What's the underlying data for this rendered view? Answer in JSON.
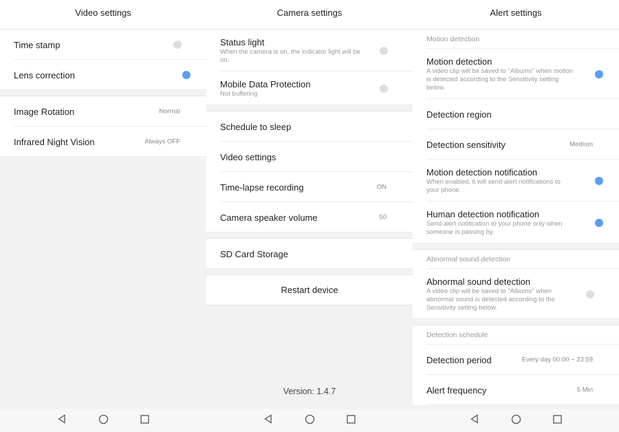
{
  "colors": {
    "toggle_on": "#5b9ef0",
    "toggle_off": "#dedede"
  },
  "panels": [
    {
      "title": "Video settings",
      "items": [
        {
          "type": "row",
          "title": "Time stamp",
          "toggle": false
        },
        {
          "type": "row",
          "title": "Lens correction",
          "toggle": true,
          "last": true
        },
        {
          "type": "gap"
        },
        {
          "type": "row",
          "title": "Image Rotation",
          "value": "Normal"
        },
        {
          "type": "row",
          "title": "Infrared Night Vision",
          "value": "Always OFF",
          "last": true
        }
      ]
    },
    {
      "title": "Camera settings",
      "version": "Version: 1.4.7",
      "items": [
        {
          "type": "row",
          "title": "Status light",
          "desc": "When the camera is on, the indicator light will be on.",
          "toggle": false
        },
        {
          "type": "row",
          "title": "Mobile Data Protection",
          "desc": "Not buffering",
          "toggle": false,
          "last": true
        },
        {
          "type": "gap"
        },
        {
          "type": "row",
          "title": "Schedule to sleep"
        },
        {
          "type": "row",
          "title": "Video settings"
        },
        {
          "type": "row",
          "title": "Time-lapse recording",
          "value": "ON"
        },
        {
          "type": "row",
          "title": "Camera speaker volume",
          "value": "50",
          "last": true
        },
        {
          "type": "gap"
        },
        {
          "type": "row",
          "title": "SD Card Storage",
          "last": true
        },
        {
          "type": "gap"
        },
        {
          "type": "button",
          "title": "Restart device"
        }
      ]
    },
    {
      "title": "Alert settings",
      "items": [
        {
          "type": "section",
          "title": "Motion detection"
        },
        {
          "type": "row",
          "title": "Motion detection",
          "desc": "A video clip will be saved to \"Albums\" when motion is detected according to the Sensitivity setting below.",
          "toggle": true
        },
        {
          "type": "row",
          "title": "Detection region"
        },
        {
          "type": "row",
          "title": "Detection sensitivity",
          "value": "Medium"
        },
        {
          "type": "row",
          "title": "Motion detection notification",
          "desc": "When enabled, it will send alert notifications to your phone.",
          "toggle": true
        },
        {
          "type": "row",
          "title": "Human detection notification",
          "desc": "Send alert notification to your phone only when someone is passing by.",
          "toggle": true,
          "last": true
        },
        {
          "type": "gap"
        },
        {
          "type": "section",
          "title": "Abnormal sound detection"
        },
        {
          "type": "row",
          "title": "Abnormal sound detection",
          "desc": "A video clip will be saved to \"Albums\" when abnormal sound is detected according to the Sensitivity setting below.",
          "toggle": false,
          "last": true
        },
        {
          "type": "gap"
        },
        {
          "type": "section",
          "title": "Detection schedule"
        },
        {
          "type": "row",
          "title": "Detection period",
          "value": "Every day 00:00 ~ 23:59"
        },
        {
          "type": "row",
          "title": "Alert frequency",
          "value": "5 Min"
        }
      ]
    }
  ],
  "navbar": {
    "icons": [
      "back-icon",
      "home-icon",
      "recents-icon"
    ]
  }
}
